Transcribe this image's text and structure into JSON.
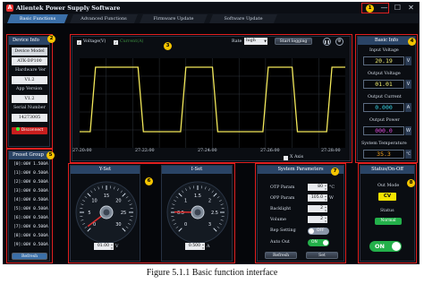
{
  "window": {
    "title": "Alientek Power Supply Software",
    "app_icon_glyph": "A",
    "minimize_glyph": "—",
    "maximize_glyph": "☐",
    "close_glyph": "✕"
  },
  "markers": [
    "1",
    "2",
    "3",
    "4",
    "5",
    "6",
    "7",
    "8"
  ],
  "tabs": [
    {
      "label": "Basic Functions",
      "active": true
    },
    {
      "label": "Advanced Functions",
      "active": false
    },
    {
      "label": "Firmware Update",
      "active": false
    },
    {
      "label": "Software Update",
      "active": false
    }
  ],
  "device_info": {
    "header": "Device Info",
    "model_label": "Device Model",
    "model_value": "ATK-DP100",
    "hw_label": "Hardware Ver",
    "hw_value": "V1.2",
    "app_label": "App Version",
    "app_value": "V1.2",
    "serial_label": "Serial Number",
    "serial_value": "14273005",
    "disconnect": "Disconnect"
  },
  "preset_group": {
    "header": "Preset Group",
    "items": [
      "[0]:00V 1.500A",
      "[1]:00V 0.500A",
      "[2]:00V 0.500A",
      "[3]:00V 0.500A",
      "[4]:00V 0.500A",
      "[5]:00V 0.500A",
      "[6]:00V 0.500A",
      "[7]:00V 0.500A",
      "[8]:00V 0.500A",
      "[9]:00V 0.500A"
    ],
    "refresh": "Refresh"
  },
  "chart_panel": {
    "voltage_check": "Voltage(V)",
    "current_check": "Current(A)",
    "rate_label": "Rate",
    "rate_value": "high",
    "start_logging": "Start logging",
    "pause_icon": "pause-icon",
    "settings_icon": "settings-icon",
    "x_axis_label": "X Axis",
    "colors": {
      "voltage": "#f2e85a",
      "grid": "#3a4048",
      "bg": "#000000"
    }
  },
  "chart_data": {
    "type": "line",
    "x": [
      "27:20:00",
      "27:22:00",
      "27:24:00",
      "27:26:00",
      "27:28:00"
    ],
    "series": [
      {
        "name": "Voltage(V)",
        "points": [
          [
            0,
            0.1
          ],
          [
            0.04,
            0.1
          ],
          [
            0.06,
            1
          ],
          [
            0.22,
            1
          ],
          [
            0.24,
            0.1
          ],
          [
            0.38,
            0.1
          ],
          [
            0.4,
            1
          ],
          [
            0.5,
            1
          ],
          [
            0.52,
            0.1
          ],
          [
            0.69,
            0.1
          ],
          [
            0.71,
            1
          ],
          [
            0.8,
            1
          ],
          [
            0.82,
            0.1
          ],
          [
            0.93,
            0.1
          ],
          [
            0.95,
            1
          ],
          [
            1,
            1
          ]
        ]
      }
    ]
  },
  "basic_info": {
    "header": "Basic Info",
    "input_voltage_label": "Input Voltage",
    "input_voltage_value": "20.19",
    "output_voltage_label": "Output Voltage",
    "output_voltage_value": "01.01",
    "output_current_label": "Output Current",
    "output_current_value": "0.000",
    "output_power_label": "Output Power",
    "output_power_value": "000.0",
    "system_temp_label": "System Temperature",
    "system_temp_value": "35.3",
    "units": {
      "v": "V",
      "a": "A",
      "w": "W",
      "c": "°C"
    }
  },
  "y_set": {
    "header": "Y-Set",
    "ticks": [
      "0",
      "5",
      "10",
      "15",
      "20",
      "25",
      "30"
    ],
    "value": "01.00",
    "unit": "V",
    "level": 0.03
  },
  "i_set": {
    "header": "I-Set",
    "ticks": [
      "0",
      "0.5",
      "1",
      "1.5",
      "2",
      "2.5",
      "3"
    ],
    "value": "0.500",
    "unit": "A",
    "level": 0.17
  },
  "system_params": {
    "header": "System Parameters",
    "otp_label": "OTP Param",
    "otp_value": "80",
    "otp_unit": "°C",
    "opp_label": "OPP Param",
    "opp_value": "105.0",
    "opp_unit": "W",
    "backlight_label": "Backlight",
    "backlight_value": "2",
    "volume_label": "Volume",
    "volume_value": "2",
    "rep_label": "Rep Setting",
    "rep_state": "OFF",
    "autoout_label": "Auto Out",
    "autoout_state": "ON",
    "refresh": "Refresh",
    "set": "Set"
  },
  "status": {
    "header": "Status/On-Off",
    "mode_label": "Out Mode",
    "mode_value": "CV",
    "status_label": "Status",
    "status_value": "Normal",
    "power_state": "ON",
    "colors": {
      "mode": "#f5e400",
      "normal": "#23b04a"
    }
  },
  "caption": "Figure 5.1.1 Basic function interface"
}
